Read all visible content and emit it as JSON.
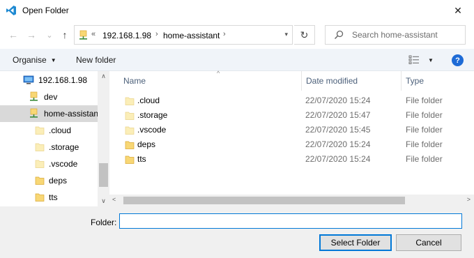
{
  "window": {
    "title": "Open Folder",
    "close_glyph": "✕"
  },
  "nav": {
    "back_glyph": "←",
    "forward_glyph": "→",
    "history_glyph": "⌄",
    "up_glyph": "↑",
    "address": {
      "overflow": "«",
      "segments": [
        "192.168.1.98",
        "home-assistant"
      ],
      "separator": "›"
    },
    "refresh_glyph": "↻",
    "search_placeholder": "Search home-assistant"
  },
  "toolbar": {
    "organise": "Organise",
    "new_folder": "New folder",
    "help": "?"
  },
  "tree": {
    "items": [
      {
        "label": "192.168.1.98",
        "icon": "computer-icon",
        "selected": false
      },
      {
        "label": "dev",
        "icon": "network-folder-icon",
        "selected": false
      },
      {
        "label": "home-assistant",
        "icon": "network-folder-icon",
        "selected": true
      },
      {
        "label": ".cloud",
        "icon": "folder-icon-light",
        "selected": false
      },
      {
        "label": ".storage",
        "icon": "folder-icon-light",
        "selected": false
      },
      {
        "label": ".vscode",
        "icon": "folder-icon-light",
        "selected": false
      },
      {
        "label": "deps",
        "icon": "folder-icon",
        "selected": false
      },
      {
        "label": "tts",
        "icon": "folder-icon",
        "selected": false
      }
    ]
  },
  "files": {
    "columns": {
      "name": "Name",
      "date": "Date modified",
      "type": "Type"
    },
    "rows": [
      {
        "name": ".cloud",
        "date": "22/07/2020 15:24",
        "type": "File folder",
        "icon": "folder-icon-light"
      },
      {
        "name": ".storage",
        "date": "22/07/2020 15:47",
        "type": "File folder",
        "icon": "folder-icon-light"
      },
      {
        "name": ".vscode",
        "date": "22/07/2020 15:45",
        "type": "File folder",
        "icon": "folder-icon-light"
      },
      {
        "name": "deps",
        "date": "22/07/2020 15:24",
        "type": "File folder",
        "icon": "folder-icon"
      },
      {
        "name": "tts",
        "date": "22/07/2020 15:24",
        "type": "File folder",
        "icon": "folder-icon"
      }
    ]
  },
  "bottom": {
    "folder_label": "Folder:",
    "folder_value": "",
    "select_button": "Select Folder",
    "cancel_button": "Cancel"
  },
  "colors": {
    "accent": "#0078d7",
    "selected_bg": "#d9d9d9",
    "folder": "#f8d775",
    "folder_light": "#fbeeb8"
  }
}
